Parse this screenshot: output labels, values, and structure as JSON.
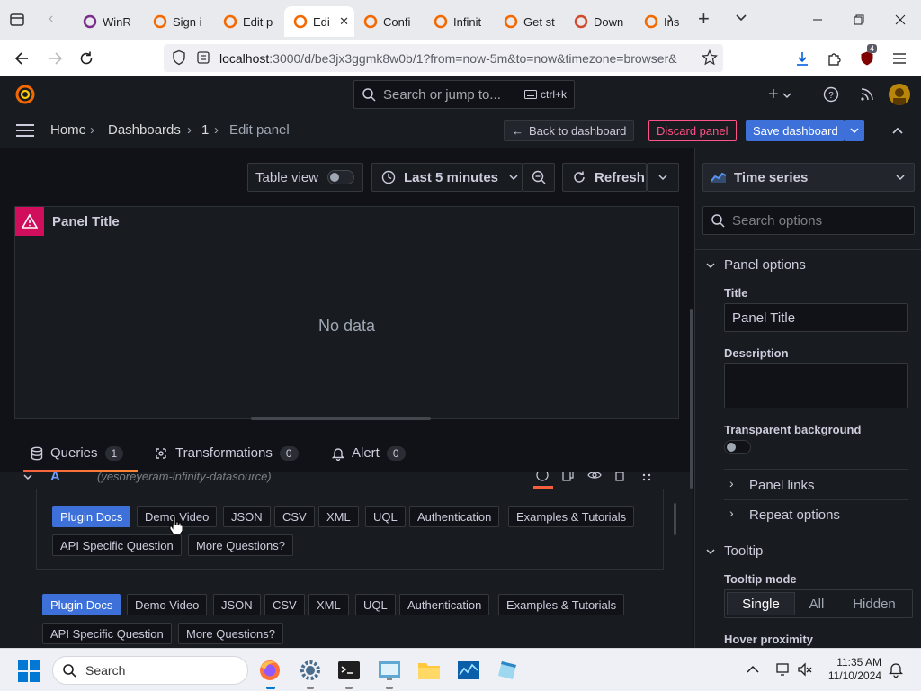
{
  "browser": {
    "tabs": [
      {
        "label": "WinR",
        "active": false
      },
      {
        "label": "Sign i",
        "active": false
      },
      {
        "label": "Edit p",
        "active": false
      },
      {
        "label": "Edi",
        "active": true
      },
      {
        "label": "Confi",
        "active": false
      },
      {
        "label": "Infinit",
        "active": false
      },
      {
        "label": "Get st",
        "active": false
      },
      {
        "label": "Down",
        "active": false
      },
      {
        "label": "Ins",
        "active": false
      }
    ],
    "url_host": "localhost",
    "url_rest": ":3000/d/be3jx3ggmk8w0b/1?from=now-5m&to=now&timezone=browser&",
    "extension_badge": "4"
  },
  "grafana": {
    "search_placeholder": "Search or jump to...",
    "search_shortcut": "ctrl+k",
    "breadcrumb": [
      "Home",
      "Dashboards",
      "1",
      "Edit panel"
    ],
    "back_button": "Back to dashboard",
    "discard_button": "Discard panel",
    "save_button": "Save dashboard"
  },
  "toolbar": {
    "table_view": "Table view",
    "time_range": "Last 5 minutes",
    "refresh": "Refresh"
  },
  "panel": {
    "title": "Panel Title",
    "empty": "No data"
  },
  "editor_tabs": [
    {
      "label": "Queries",
      "count": "1"
    },
    {
      "label": "Transformations",
      "count": "0"
    },
    {
      "label": "Alert",
      "count": "0"
    }
  ],
  "query": {
    "ref": "A",
    "datasource": "(yesoreyeram-infinity-datasource)",
    "links_row1": [
      "Plugin Docs",
      "Demo Video",
      "JSON",
      "CSV",
      "XML",
      "UQL",
      "Authentication",
      "Examples & Tutorials"
    ],
    "links_row1b": [
      "API Specific Question",
      "More Questions?"
    ],
    "links_row2": [
      "Plugin Docs",
      "Demo Video",
      "JSON",
      "CSV",
      "XML",
      "UQL",
      "Authentication",
      "Examples & Tutorials"
    ],
    "links_row2b": [
      "API Specific Question",
      "More Questions?"
    ]
  },
  "options": {
    "visualization": "Time series",
    "search_placeholder": "Search options",
    "panel_options": "Panel options",
    "title_label": "Title",
    "title_value": "Panel Title",
    "description_label": "Description",
    "transparent_label": "Transparent background",
    "panel_links": "Panel links",
    "repeat_options": "Repeat options",
    "tooltip": "Tooltip",
    "tooltip_mode_label": "Tooltip mode",
    "tooltip_modes": [
      "Single",
      "All",
      "Hidden"
    ],
    "hover_proximity": "Hover proximity"
  },
  "taskbar": {
    "search_placeholder": "Search",
    "time": "11:35 AM",
    "date": "11/10/2024"
  },
  "colors": {
    "accent_blue": "#3d71d9",
    "discard_red": "#ff5286",
    "grafana_orange": "#f46800",
    "panel_warn": "#d10e5c"
  }
}
